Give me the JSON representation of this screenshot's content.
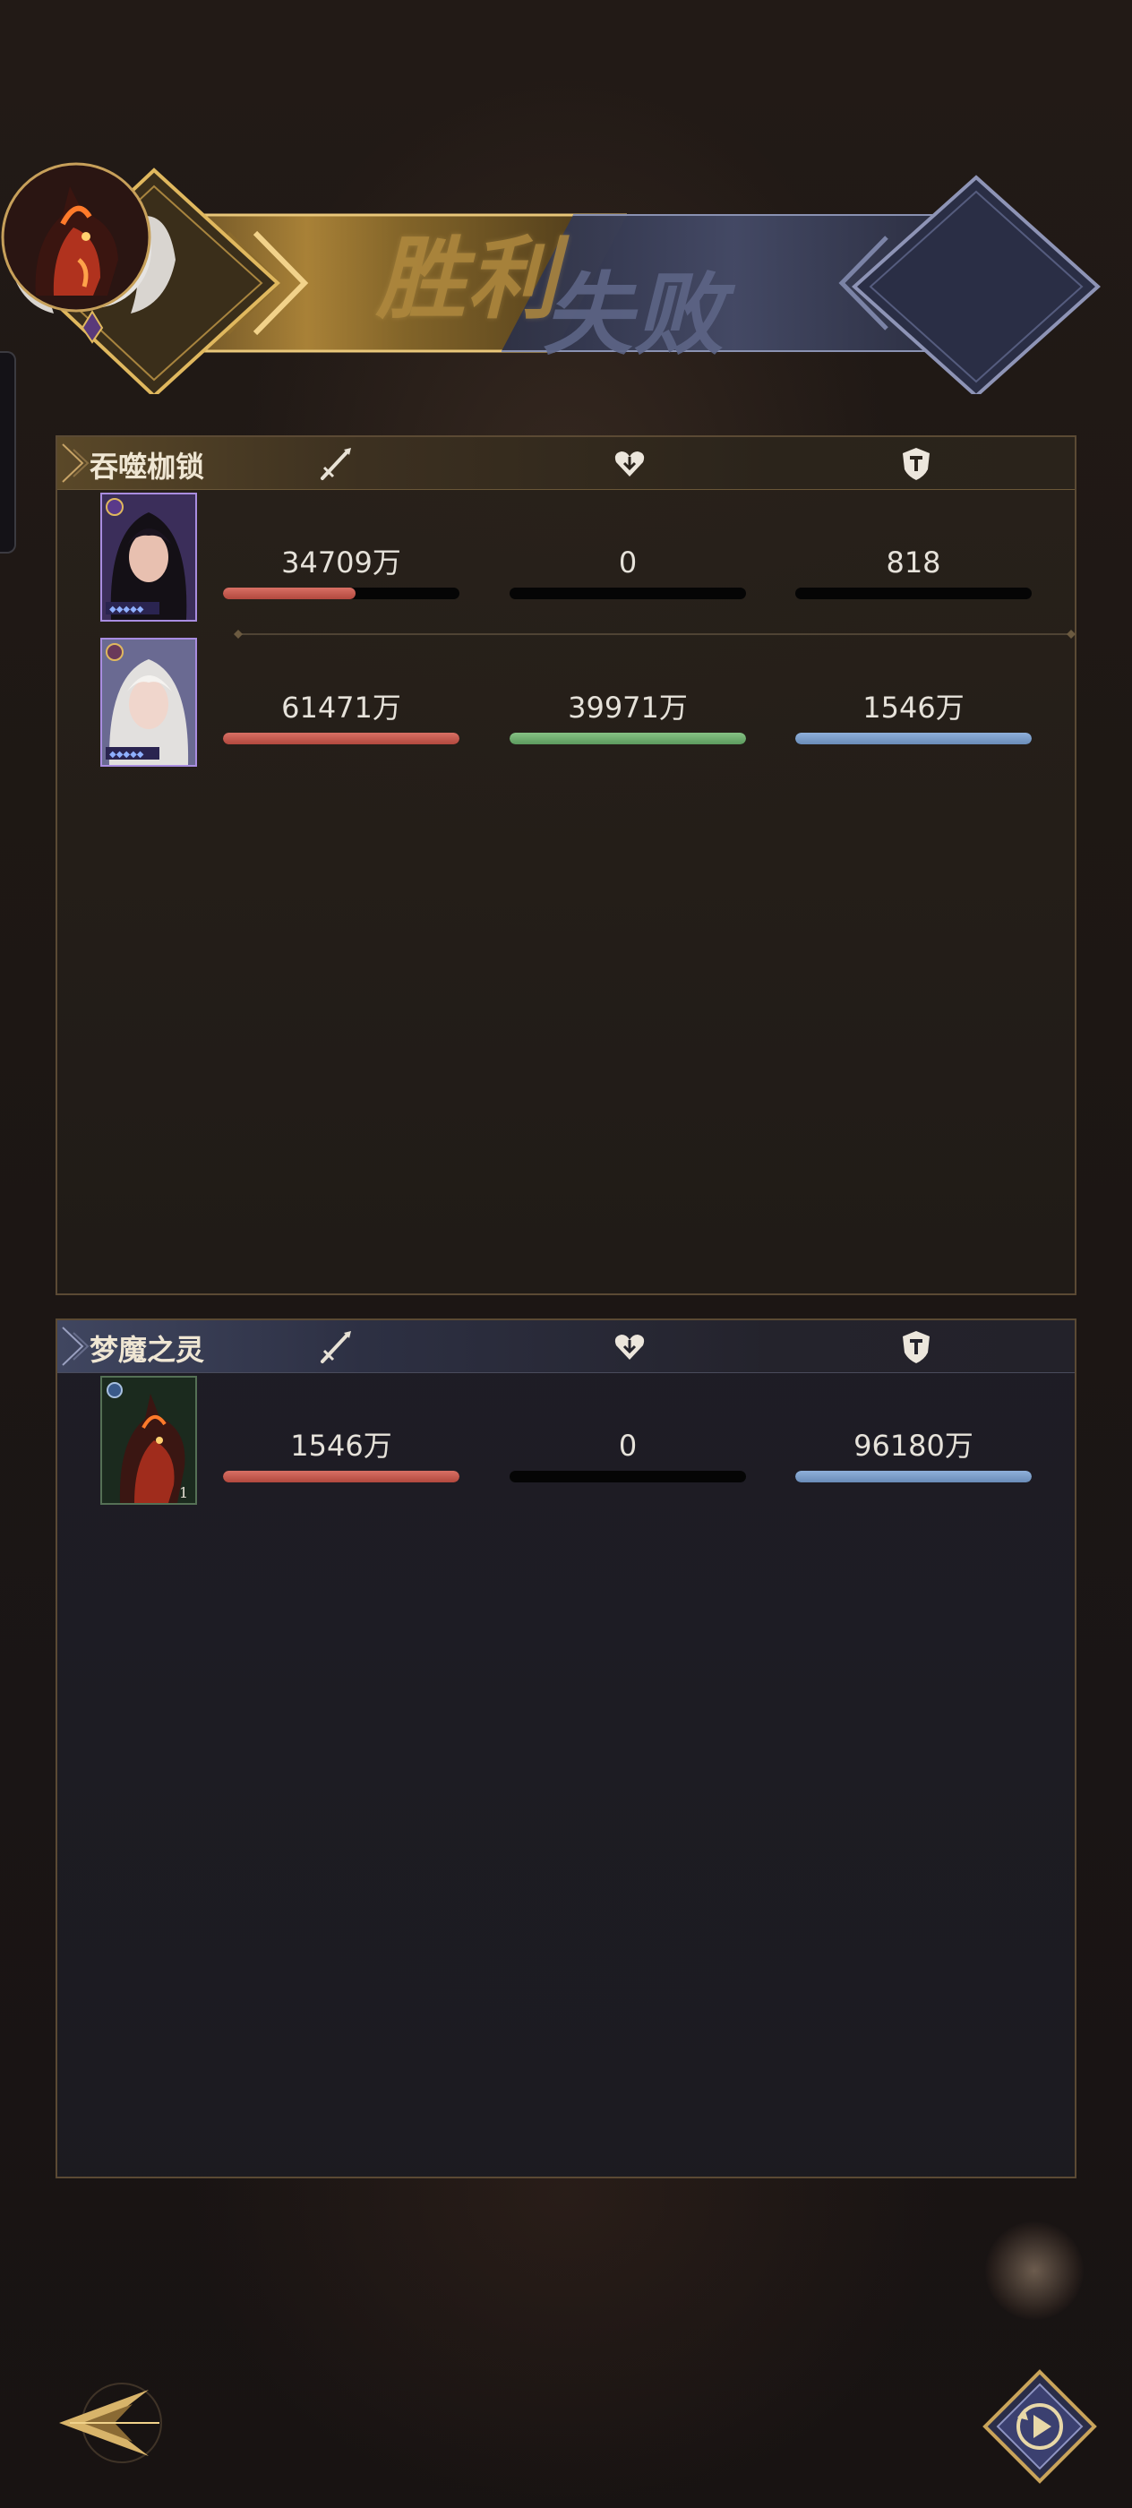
{
  "header": {
    "victory_label": "胜利",
    "defeat_label": "失败",
    "left_avatar": "white-haired-angel-hero-avatar",
    "right_avatar": "flame-horse-boss-avatar"
  },
  "teams": [
    {
      "name": "吞噬枷锁",
      "columns": {
        "damage_icon": "sword-icon",
        "heal_icon": "heart-icon",
        "tank_icon": "shield-icon"
      },
      "members": [
        {
          "portrait": "dark-haired-witch-card",
          "damage": "34709万",
          "heal": "0",
          "tank": "818",
          "damage_fill": 0.56,
          "heal_fill": 0,
          "tank_fill": 0
        },
        {
          "portrait": "white-haired-angel-card",
          "damage": "61471万",
          "heal": "39971万",
          "tank": "1546万",
          "damage_fill": 1.0,
          "heal_fill": 1.0,
          "tank_fill": 1.0
        }
      ]
    },
    {
      "name": "梦魔之灵",
      "columns": {
        "damage_icon": "sword-icon",
        "heal_icon": "heart-icon",
        "tank_icon": "shield-icon"
      },
      "members": [
        {
          "portrait": "red-demon-horse-card",
          "level": "1",
          "damage": "1546万",
          "heal": "0",
          "tank": "96180万",
          "damage_fill": 1.0,
          "heal_fill": 0,
          "tank_fill": 1.0
        }
      ]
    }
  ],
  "controls": {
    "back_icon": "back-arrow-icon",
    "replay_icon": "replay-icon"
  },
  "colors": {
    "damage": "#c65a50",
    "heal": "#6faf70",
    "tank": "#7c9ecb",
    "victory_gold": "#b18a3f",
    "defeat_slate": "#5d6586"
  }
}
